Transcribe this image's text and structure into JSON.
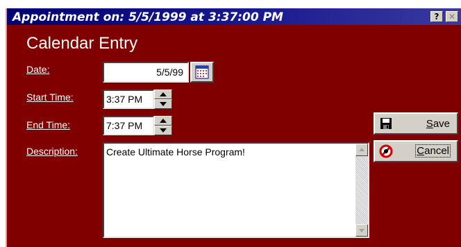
{
  "window": {
    "title": "Appointment on: 5/5/1999 at 3:37:00 PM",
    "help_glyph": "?",
    "close_glyph": "✕"
  },
  "form": {
    "heading": "Calendar Entry",
    "date_label": "Date:",
    "date_value": "5/5/99",
    "start_label": "Start Time:",
    "start_value": "3:37 PM",
    "end_label": "End Time:",
    "end_value": "7:37 PM",
    "description_label": "Description:",
    "description_value": "Create Ultimate Horse Program!"
  },
  "buttons": {
    "save_first": "S",
    "save_rest": "ave",
    "cancel_first": "C",
    "cancel_rest": "ancel"
  },
  "icons": {
    "calendar": "calendar-icon",
    "save": "floppy-disk-icon",
    "cancel": "no-sign-icon"
  },
  "colors": {
    "window_background": "#800000",
    "titlebar": "#000070",
    "control_face": "#d4d0c8"
  }
}
